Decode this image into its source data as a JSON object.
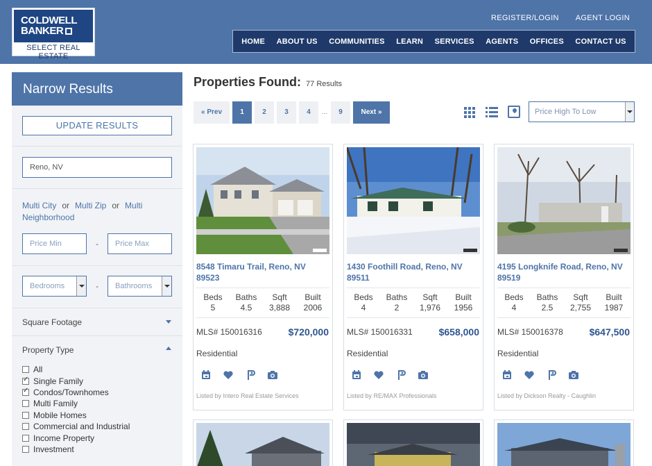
{
  "brand": {
    "logo_line1": "COLDWELL",
    "logo_line2": "BANKER",
    "logo_sub": "SELECT REAL ESTATE",
    "color": "#4e74a8",
    "dark": "#1f3a6a"
  },
  "top_links": [
    "REGISTER/LOGIN",
    "AGENT LOGIN"
  ],
  "nav": [
    "HOME",
    "ABOUT US",
    "COMMUNITIES",
    "LEARN",
    "SERVICES",
    "AGENTS",
    "OFFICES",
    "CONTACT US"
  ],
  "sidebar": {
    "title": "Narrow Results",
    "update_button": "UPDATE RESULTS",
    "location_value": "Reno, NV",
    "multi_city": "Multi City",
    "multi_zip": "Multi Zip",
    "multi_neighborhood": "Multi Neighborhood",
    "or": "or",
    "dash": "-",
    "price_min_placeholder": "Price Min",
    "price_max_placeholder": "Price Max",
    "bedrooms": "Bedrooms",
    "bathrooms": "Bathrooms",
    "square_footage": "Square Footage",
    "property_type": "Property Type",
    "property_types": [
      {
        "label": "All",
        "checked": false
      },
      {
        "label": "Single Family",
        "checked": true
      },
      {
        "label": "Condos/Townhomes",
        "checked": true
      },
      {
        "label": "Multi Family",
        "checked": false
      },
      {
        "label": "Mobile Homes",
        "checked": false
      },
      {
        "label": "Commercial and Industrial",
        "checked": false
      },
      {
        "label": "Income Property",
        "checked": false
      },
      {
        "label": "Investment",
        "checked": false
      }
    ]
  },
  "results": {
    "title": "Properties Found:",
    "count": "77 Results",
    "pager": {
      "prev": "« Prev",
      "pages": [
        "1",
        "2",
        "3",
        "4"
      ],
      "ellipsis": "...",
      "last": "9",
      "next": "Next »",
      "current": "1"
    },
    "sort_value": "Price High To Low",
    "view_icons": [
      "grid-view-icon",
      "list-view-icon",
      "map-view-icon"
    ]
  },
  "stat_labels": {
    "beds": "Beds",
    "baths": "Baths",
    "sqft": "Sqft",
    "built": "Built"
  },
  "listings": [
    {
      "address": "8548 Timaru Trail, Reno, NV 89523",
      "beds": "5",
      "baths": "4.5",
      "sqft": "3,888",
      "built": "2006",
      "mls": "MLS# 150016316",
      "price": "$720,000",
      "type": "Residential",
      "listed_by": "Listed by Intero Real Estate Services"
    },
    {
      "address": "1430 Foothill Road, Reno, NV 89511",
      "beds": "4",
      "baths": "2",
      "sqft": "1,976",
      "built": "1956",
      "mls": "MLS# 150016331",
      "price": "$658,000",
      "type": "Residential",
      "listed_by": "Listed by RE/MAX Professionals"
    },
    {
      "address": "4195 Longknife Road, Reno, NV 89519",
      "beds": "4",
      "baths": "2.5",
      "sqft": "2,755",
      "built": "1987",
      "mls": "MLS# 150016378",
      "price": "$647,500",
      "type": "Residential",
      "listed_by": "Listed by Dickson Realty - Caughlin"
    }
  ],
  "card_icons": [
    "calendar-icon",
    "heart-icon",
    "map-pin-icon",
    "camera-icon"
  ]
}
